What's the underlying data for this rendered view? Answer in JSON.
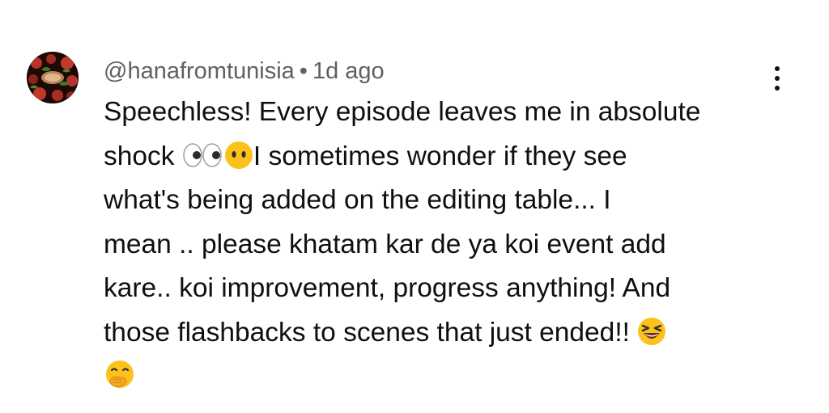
{
  "comment": {
    "author": "@hanafromtunisia",
    "separator": "•",
    "time": "1d ago",
    "avatar_colors": {
      "background": "#1d0a06",
      "accent_red": "#c0392b",
      "accent_green": "#3e7a2a"
    },
    "lines": [
      {
        "text": "Speechless! Every episode leaves me in absolute"
      },
      {
        "before": "shock ",
        "emoji1": "eyes",
        "emoji2": "face-without-mouth",
        "after": "I sometimes wonder if they see"
      },
      {
        "text": "what's being added on the editing table... I"
      },
      {
        "text": "mean .. please khatam kar de ya koi event add"
      },
      {
        "text": "kare.. koi improvement, progress anything! And"
      },
      {
        "before": "those flashbacks to scenes that just ended!! ",
        "emoji1": "grinning-squinting-face"
      },
      {
        "emoji1": "face-with-hand-over-mouth"
      }
    ]
  },
  "actions": {
    "menu_icon": "more-vertical-icon"
  }
}
